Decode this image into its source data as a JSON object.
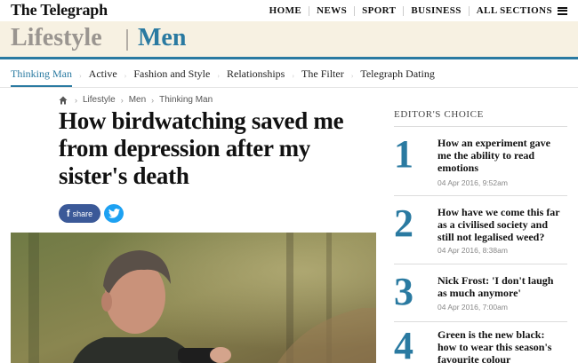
{
  "site": {
    "logo": "The Telegraph"
  },
  "topnav": {
    "items": [
      "HOME",
      "NEWS",
      "SPORT",
      "BUSINESS",
      "ALL SECTIONS"
    ],
    "menu_icon": "hamburger-icon"
  },
  "banner": {
    "section": "Lifestyle",
    "subsection": "Men"
  },
  "subnav": {
    "items": [
      "Thinking Man",
      "Active",
      "Fashion and Style",
      "Relationships",
      "The Filter",
      "Telegraph Dating"
    ],
    "active": "Thinking Man"
  },
  "breadcrumb": {
    "home_icon": "home-icon",
    "items": [
      "Lifestyle",
      "Men",
      "Thinking Man"
    ]
  },
  "article": {
    "headline": "How birdwatching saved me from depression after my sister's death",
    "share_label": "share",
    "facebook_letter": "f"
  },
  "editors_choice": {
    "title": "EDITOR'S CHOICE",
    "items": [
      {
        "num": "1",
        "headline": "How an experiment gave me the ability to read emotions",
        "date": "04 Apr 2016, 9:52am"
      },
      {
        "num": "2",
        "headline": "How have we come this far as a civilised society and still not legalised weed?",
        "date": "04 Apr 2016, 8:38am"
      },
      {
        "num": "3",
        "headline": "Nick Frost: 'I don't laugh as much anymore'",
        "date": "04 Apr 2016, 7:00am"
      },
      {
        "num": "4",
        "headline": "Green is the new black: how to wear this season's favourite colour",
        "date": ""
      }
    ]
  },
  "colors": {
    "accent": "#2a7aa1",
    "banner_bg": "#f7f1e2",
    "facebook": "#3b5998",
    "twitter": "#1da1f2"
  }
}
